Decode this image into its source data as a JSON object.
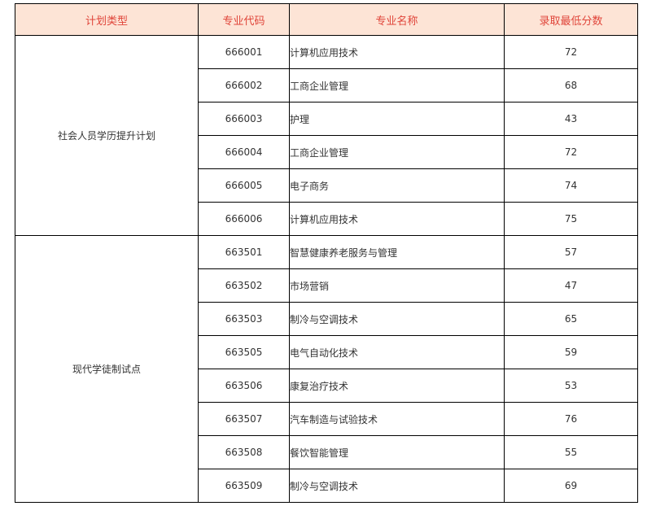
{
  "colors": {
    "header_bg": "#fde4d6",
    "header_text": "#e0453a",
    "border": "#000000",
    "cell_text": "#333333"
  },
  "table": {
    "headers": [
      "计划类型",
      "专业代码",
      "专业名称",
      "录取最低分数"
    ],
    "groups": [
      {
        "plan": "社会人员学历提升计划",
        "rows": [
          {
            "code": "666001",
            "name": "计算机应用技术",
            "score": "72"
          },
          {
            "code": "666002",
            "name": "工商企业管理",
            "score": "68"
          },
          {
            "code": "666003",
            "name": "护理",
            "score": "43"
          },
          {
            "code": "666004",
            "name": "工商企业管理",
            "score": "72"
          },
          {
            "code": "666005",
            "name": "电子商务",
            "score": "74"
          },
          {
            "code": "666006",
            "name": "计算机应用技术",
            "score": "75"
          }
        ]
      },
      {
        "plan": "现代学徒制试点",
        "rows": [
          {
            "code": "663501",
            "name": "智慧健康养老服务与管理",
            "score": "57"
          },
          {
            "code": "663502",
            "name": "市场营销",
            "score": "47"
          },
          {
            "code": "663503",
            "name": "制冷与空调技术",
            "score": "65"
          },
          {
            "code": "663505",
            "name": "电气自动化技术",
            "score": "59"
          },
          {
            "code": "663506",
            "name": "康复治疗技术",
            "score": "53"
          },
          {
            "code": "663507",
            "name": "汽车制造与试验技术",
            "score": "76"
          },
          {
            "code": "663508",
            "name": "餐饮智能管理",
            "score": "55"
          },
          {
            "code": "663509",
            "name": "制冷与空调技术",
            "score": "69"
          }
        ]
      }
    ]
  }
}
